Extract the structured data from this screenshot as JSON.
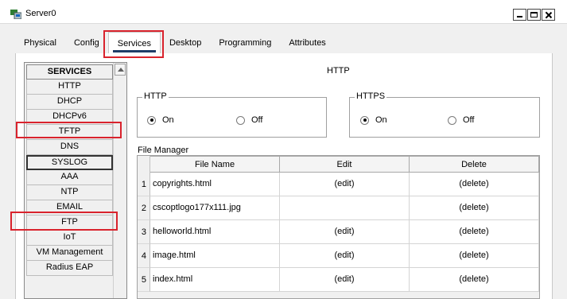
{
  "window": {
    "title": "Server0",
    "app_icon": "packet-tracer-icon"
  },
  "tabs": [
    {
      "label": "Physical"
    },
    {
      "label": "Config"
    },
    {
      "label": "Services",
      "active": true
    },
    {
      "label": "Desktop"
    },
    {
      "label": "Programming"
    },
    {
      "label": "Attributes"
    }
  ],
  "sidebar": {
    "header": "SERVICES",
    "items": [
      {
        "label": "HTTP"
      },
      {
        "label": "DHCP"
      },
      {
        "label": "DHCPv6"
      },
      {
        "label": "TFTP"
      },
      {
        "label": "DNS"
      },
      {
        "label": "SYSLOG",
        "selected": true
      },
      {
        "label": "AAA"
      },
      {
        "label": "NTP"
      },
      {
        "label": "EMAIL"
      },
      {
        "label": "FTP"
      },
      {
        "label": "IoT"
      },
      {
        "label": "VM Management"
      },
      {
        "label": "Radius EAP"
      }
    ]
  },
  "main": {
    "title": "HTTP",
    "http": {
      "legend": "HTTP",
      "on_label": "On",
      "off_label": "Off",
      "value": "On"
    },
    "https": {
      "legend": "HTTPS",
      "on_label": "On",
      "off_label": "Off",
      "value": "On"
    },
    "file_manager": {
      "label": "File Manager",
      "columns": [
        "File Name",
        "Edit",
        "Delete"
      ],
      "rows": [
        {
          "num": "1",
          "name": "copyrights.html",
          "edit": "(edit)",
          "delete": "(delete)"
        },
        {
          "num": "2",
          "name": "cscoptlogo177x111.jpg",
          "edit": "",
          "delete": "(delete)"
        },
        {
          "num": "3",
          "name": "helloworld.html",
          "edit": "(edit)",
          "delete": "(delete)"
        },
        {
          "num": "4",
          "name": "image.html",
          "edit": "(edit)",
          "delete": "(delete)"
        },
        {
          "num": "5",
          "name": "index.html",
          "edit": "(edit)",
          "delete": "(delete)"
        }
      ]
    }
  },
  "annotations": {
    "highlight_color": "#d9232d",
    "highlighted": [
      "Services",
      "TFTP",
      "FTP"
    ]
  },
  "colors": {
    "tab_underline": "#1f3d68"
  }
}
